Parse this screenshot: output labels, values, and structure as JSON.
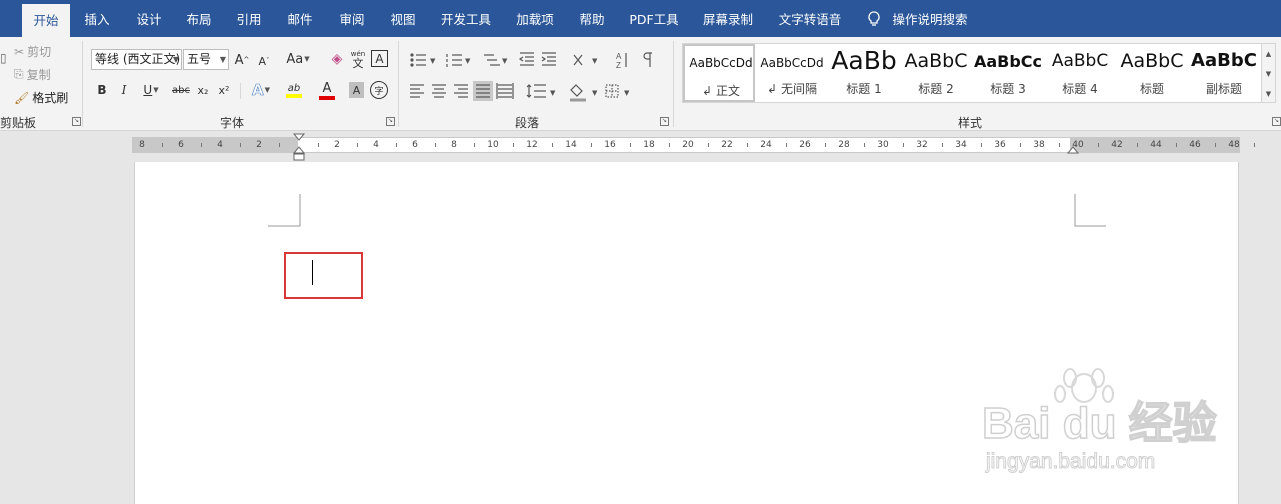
{
  "tabs": [
    {
      "label": "开始",
      "active": true
    },
    {
      "label": "插入"
    },
    {
      "label": "设计"
    },
    {
      "label": "布局"
    },
    {
      "label": "引用"
    },
    {
      "label": "邮件"
    },
    {
      "label": "审阅"
    },
    {
      "label": "视图"
    },
    {
      "label": "开发工具"
    },
    {
      "label": "加载项"
    },
    {
      "label": "帮助"
    },
    {
      "label": "PDF工具"
    },
    {
      "label": "屏幕录制"
    },
    {
      "label": "文字转语音"
    },
    {
      "label": "操作说明搜索"
    }
  ],
  "clipboard": {
    "cut": "剪切",
    "copy": "复制",
    "format_painter": "格式刷",
    "group_label": "剪贴板"
  },
  "font": {
    "family": "等线 (西文正文)",
    "size": "五号",
    "group_label": "字体",
    "grow": "A",
    "shrink": "A",
    "case": "Aa",
    "bold": "B",
    "italic": "I",
    "underline": "U",
    "strike": "abc",
    "sub": "x₂",
    "sup": "x²",
    "effects": "A",
    "highlight": "ab",
    "color": "A",
    "shade": "A",
    "enclose": "字",
    "phonetic": "wén",
    "charborder": "A"
  },
  "paragraph": {
    "group_label": "段落"
  },
  "styles": {
    "group_label": "样式",
    "items": [
      {
        "sample": "AaBbCcDd",
        "name": "正文",
        "mark": "↲"
      },
      {
        "sample": "AaBbCcDd",
        "name": "无间隔",
        "mark": "↲"
      },
      {
        "sample": "AaBb",
        "name": "标题 1"
      },
      {
        "sample": "AaBbC",
        "name": "标题 2"
      },
      {
        "sample": "AaBbCc",
        "name": "标题 3"
      },
      {
        "sample": "AaBbC",
        "name": "标题 4"
      },
      {
        "sample": "AaBbC",
        "name": "标题"
      },
      {
        "sample": "AaBbC",
        "name": "副标题"
      }
    ]
  },
  "ruler": {
    "left_numbers": [
      "8",
      "6",
      "4",
      "2"
    ],
    "right_numbers": [
      "2",
      "4",
      "6",
      "8",
      "10",
      "12",
      "14",
      "16",
      "18",
      "20",
      "22",
      "24",
      "26",
      "28",
      "30",
      "32",
      "34",
      "36",
      "38",
      "40",
      "42",
      "44",
      "46",
      "48"
    ]
  },
  "watermark": {
    "brand": "Bai du 经验",
    "url": "jingyan.baidu.com"
  },
  "colors": {
    "accent": "#2b579a",
    "highlight": "#d93838"
  }
}
